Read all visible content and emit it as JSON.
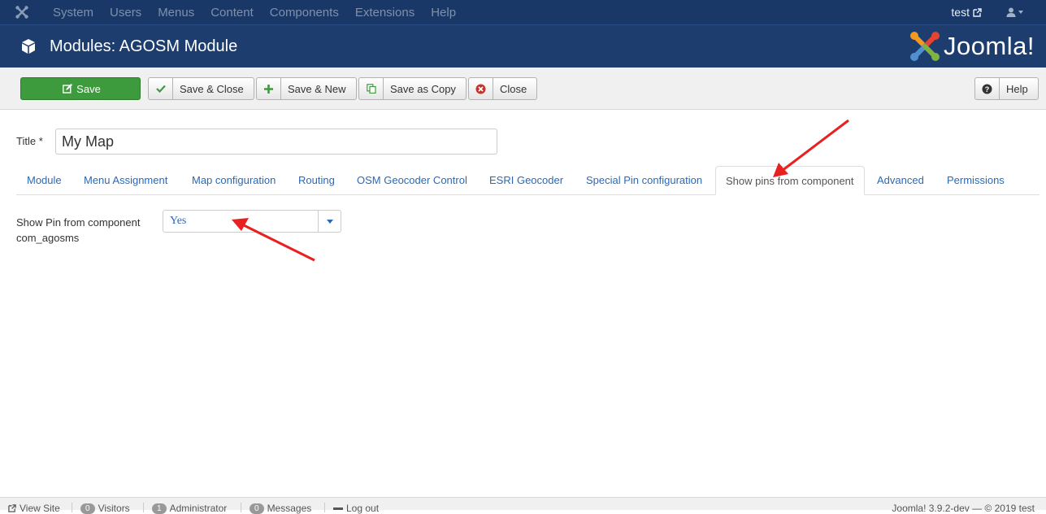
{
  "topbar": {
    "menu": [
      "System",
      "Users",
      "Menus",
      "Content",
      "Components",
      "Extensions",
      "Help"
    ],
    "user": "test"
  },
  "header": {
    "title": "Modules: AGOSM Module",
    "brand": "Joomla!"
  },
  "toolbar": {
    "save": "Save",
    "save_close": "Save & Close",
    "save_new": "Save & New",
    "save_copy": "Save as Copy",
    "close": "Close",
    "help": "Help"
  },
  "form": {
    "title_label": "Title *",
    "title_value": "My Map"
  },
  "tabs": [
    "Module",
    "Menu Assignment",
    "Map configuration",
    "Routing",
    "OSM Geocoder Control",
    "ESRI Geocoder",
    "Special Pin configuration",
    "Show pins from component",
    "Advanced",
    "Permissions"
  ],
  "active_tab": "Show pins from component",
  "field": {
    "label": "Show Pin from component com_agosms",
    "value": "Yes"
  },
  "statusbar": {
    "view_site": "View Site",
    "visitors_count": "0",
    "visitors": "Visitors",
    "admin_count": "1",
    "admin": "Administrator",
    "messages_count": "0",
    "messages": "Messages",
    "logout": "Log out",
    "version": "Joomla! 3.9.2-dev — © 2019 test"
  },
  "colors": {
    "navbar": "#1a3867",
    "header": "#1c3d6e",
    "save_green": "#3d9b3d",
    "link_blue": "#2a69b8",
    "annotation_red": "#e8201f"
  }
}
